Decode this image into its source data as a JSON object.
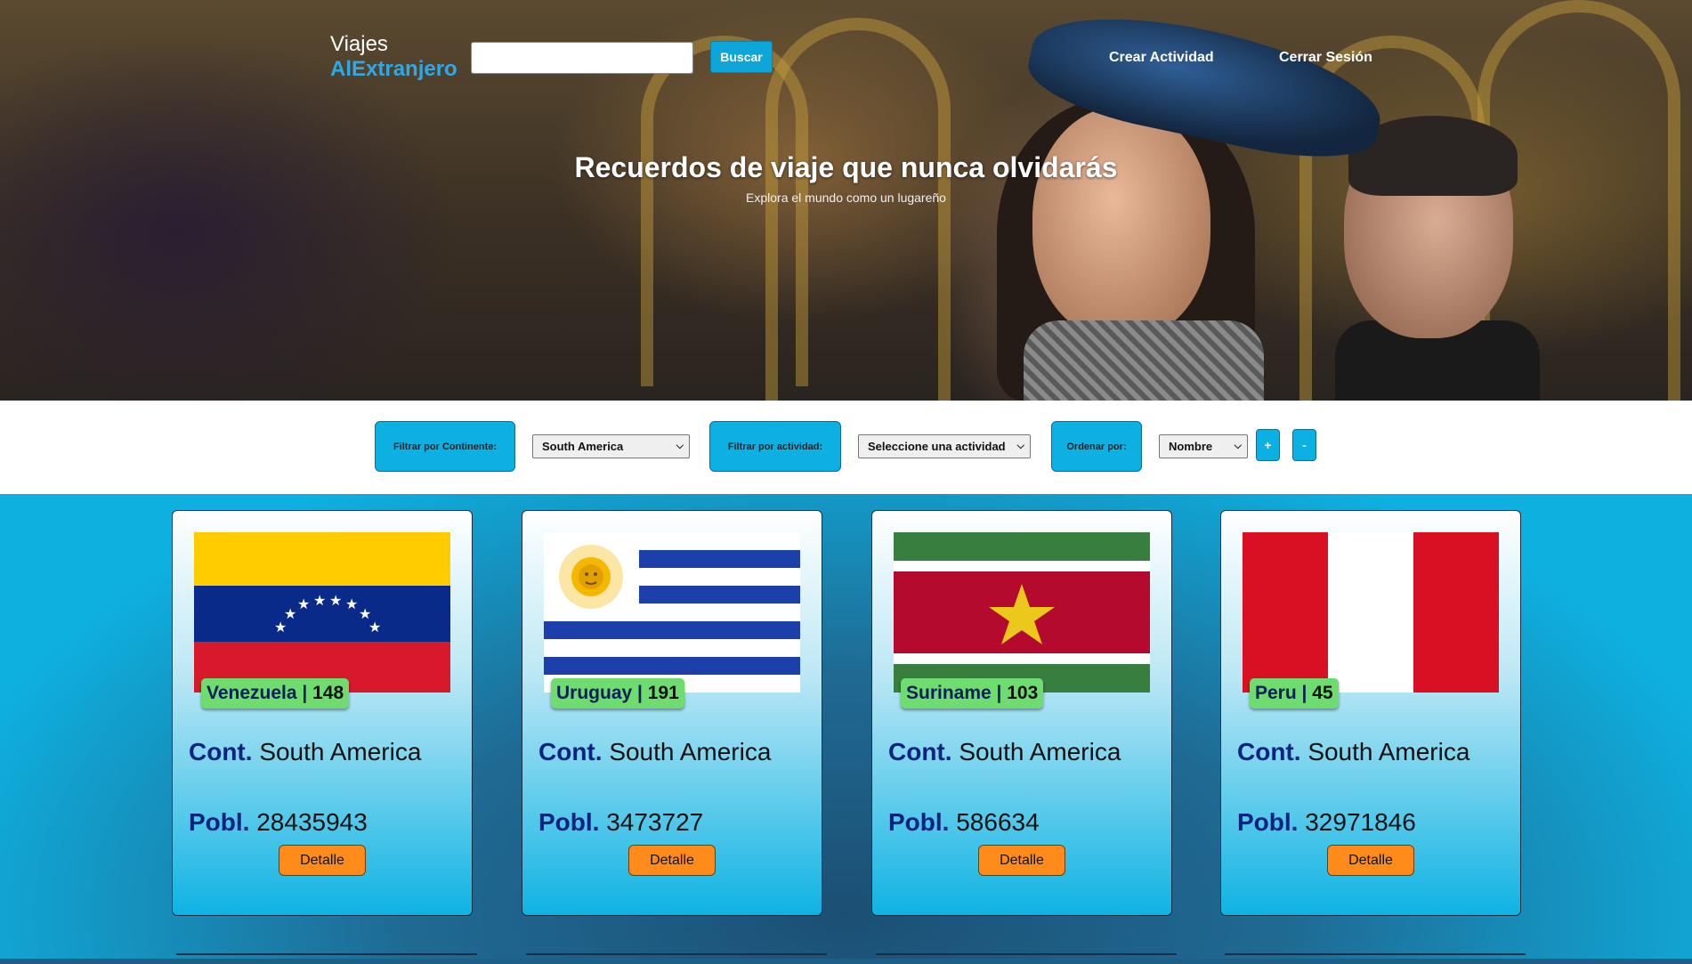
{
  "header": {
    "logo_line1": "Viajes",
    "logo_line2": "AlExtranjero",
    "search_placeholder": "",
    "search_button": "Buscar",
    "nav": [
      "Crear Actividad",
      "Cerrar Sesión"
    ]
  },
  "hero": {
    "title": "Recuerdos de viaje que nunca olvidarás",
    "subtitle": "Explora el mundo como un lugareño"
  },
  "filters": {
    "continent_label": "Filtrar por Continente:",
    "continent_value": "South America",
    "activity_label": "Filtrar por actividad:",
    "activity_value": "Seleccione una actividad",
    "order_label": "Ordenar por:",
    "order_value": "Nombre",
    "asc_label": "+",
    "desc_label": "-"
  },
  "cards": [
    {
      "name": "Venezuela",
      "id": "148",
      "cont_key": "Cont.",
      "continent": "South America",
      "pobl_key": "Pobl.",
      "population": "28435943",
      "button": "Detalle"
    },
    {
      "name": "Uruguay",
      "id": "191",
      "cont_key": "Cont.",
      "continent": "South America",
      "pobl_key": "Pobl.",
      "population": "3473727",
      "button": "Detalle"
    },
    {
      "name": "Suriname",
      "id": "103",
      "cont_key": "Cont.",
      "continent": "South America",
      "pobl_key": "Pobl.",
      "population": "586634",
      "button": "Detalle"
    },
    {
      "name": "Peru",
      "id": "45",
      "cont_key": "Cont.",
      "continent": "South America",
      "pobl_key": "Pobl.",
      "population": "32971846",
      "button": "Detalle"
    }
  ],
  "colors": {
    "accent": "#0db0e3",
    "badge": "#6edc6e",
    "detail_button": "#ff8c1a",
    "key_text": "#0a2280"
  }
}
